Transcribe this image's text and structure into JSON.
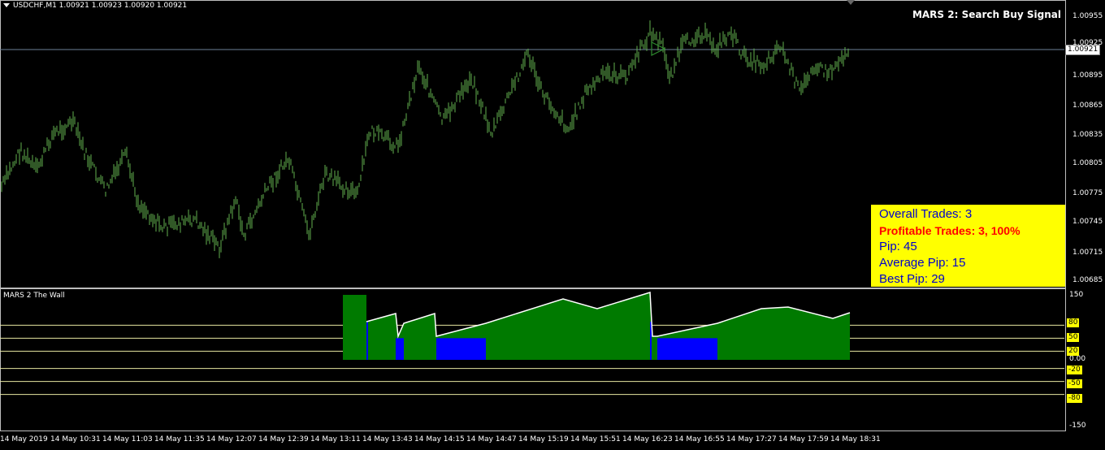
{
  "main_chart": {
    "symbol_label": "USDCHF,M1  1.00921 1.00923 1.00920 1.00921",
    "ea_title": "MARS 2: Search Buy Signal",
    "current_price": "1.00921",
    "price_axis": [
      "1.00955",
      "1.00925",
      "1.00895",
      "1.00865",
      "1.00835",
      "1.00805",
      "1.00775",
      "1.00745",
      "1.00715",
      "1.00685"
    ],
    "colors": {
      "candles": "#62b04e",
      "price_line": "#6b7f99",
      "background": "#000000"
    }
  },
  "stats_panel": {
    "overall_trades": "Overall Trades: 3",
    "profitable_trades": "Profitable Trades: 3, 100%",
    "pip": "Pip: 45",
    "average_pip": "Average Pip: 15",
    "best_pip": "Best Pip: 29"
  },
  "indicator": {
    "name": "MARS 2 The Wall",
    "axis_max": "150",
    "axis_zero": "0.00",
    "axis_min": "-150",
    "levels": [
      "80",
      "50",
      "20",
      "-20",
      "-50",
      "-80"
    ],
    "colors": {
      "area": "#007a00",
      "highlight": "#0000ff",
      "line": "#ffffff",
      "level": "#e6e6a0"
    }
  },
  "time_axis": [
    "14 May 2019",
    "14 May 10:31",
    "14 May 11:03",
    "14 May 11:35",
    "14 May 12:07",
    "14 May 12:39",
    "14 May 13:11",
    "14 May 13:43",
    "14 May 14:15",
    "14 May 14:47",
    "14 May 15:19",
    "14 May 15:51",
    "14 May 16:23",
    "14 May 16:55",
    "14 May 17:27",
    "14 May 17:59",
    "14 May 18:31"
  ]
}
